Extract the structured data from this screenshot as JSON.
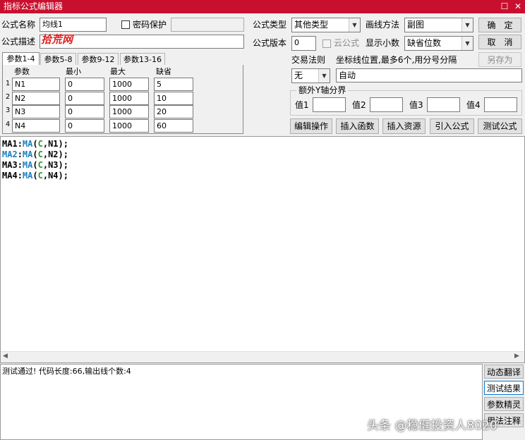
{
  "window": {
    "title": "指标公式编辑器",
    "restore_glyph": "☐",
    "close_glyph": "✕"
  },
  "formula": {
    "name_label": "公式名称",
    "name_value": "均线1",
    "password_label": "密码保护",
    "password_value": "",
    "desc_label": "公式描述",
    "desc_value": "",
    "desc_logo_text": "拾荒网",
    "type_label": "公式类型",
    "type_value": "其他类型",
    "draw_label": "画线方法",
    "draw_value": "副图",
    "version_label": "公式版本",
    "version_value": "0",
    "cloud_label": "云公式",
    "decimal_label": "显示小数",
    "decimal_value": "缺省位数"
  },
  "buttons": {
    "ok": "确　定",
    "cancel": "取　消",
    "save_as": "另存为",
    "edit_op": "编辑操作",
    "insert_func": "插入函数",
    "insert_res": "插入资源",
    "import_formula": "引入公式",
    "test_formula": "测试公式"
  },
  "params": {
    "tabs": [
      "参数1-4",
      "参数5-8",
      "参数9-12",
      "参数13-16"
    ],
    "headers": [
      "参数",
      "最小",
      "最大",
      "缺省"
    ],
    "rows": [
      {
        "idx": "1",
        "name": "N1",
        "min": "0",
        "max": "1000",
        "def": "5"
      },
      {
        "idx": "2",
        "name": "N2",
        "min": "0",
        "max": "1000",
        "def": "10"
      },
      {
        "idx": "3",
        "name": "N3",
        "min": "0",
        "max": "1000",
        "def": "20"
      },
      {
        "idx": "4",
        "name": "N4",
        "min": "0",
        "max": "1000",
        "def": "60"
      }
    ]
  },
  "trading": {
    "rule_label": "交易法则",
    "rule_value": "无",
    "axis_label": "坐标线位置,最多6个,用分号分隔",
    "axis_value": "自动"
  },
  "y_axis": {
    "group_label": "额外Y轴分界",
    "labels": [
      "值1",
      "值2",
      "值3",
      "值4"
    ],
    "values": [
      "",
      "",
      "",
      ""
    ]
  },
  "code": {
    "lines": [
      {
        "var": "MA1",
        "fn": "MA",
        "arg1": "C",
        "arg2": "N1"
      },
      {
        "var": "MA2",
        "fn": "MA",
        "arg1": "C",
        "arg2": "N2"
      },
      {
        "var": "MA3",
        "fn": "MA",
        "arg1": "C",
        "arg2": "N3"
      },
      {
        "var": "MA4",
        "fn": "MA",
        "arg1": "C",
        "arg2": "N4"
      }
    ]
  },
  "output": {
    "message": "测试通过! 代码长度:66,输出线个数:4"
  },
  "side_buttons": {
    "dynamic_translate": "动态翻译",
    "test_result": "测试结果",
    "param_wizard": "参数精灵",
    "usage_note": "用法注释"
  },
  "watermark": "头条 @稳健投资人8020",
  "colors": {
    "titlebar": "#c8102e",
    "function": "#1a7fbf",
    "constant": "#2a9a2a"
  }
}
